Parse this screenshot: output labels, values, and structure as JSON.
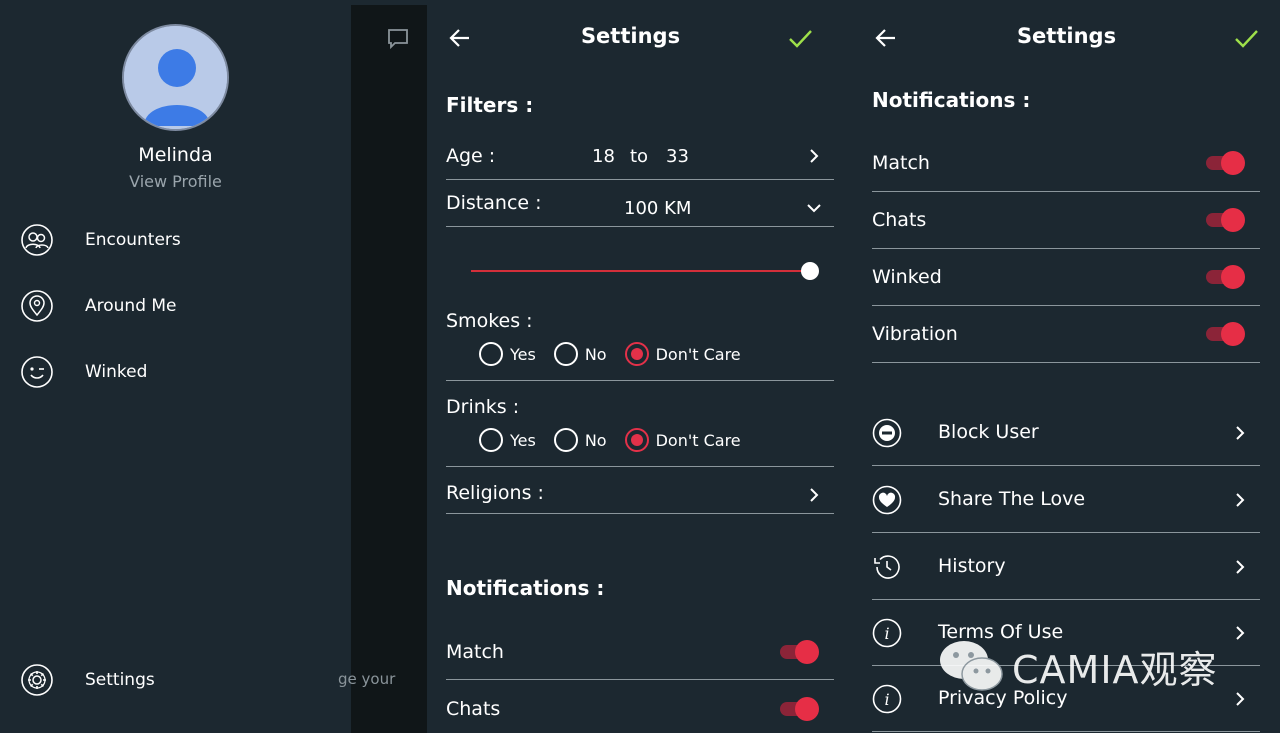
{
  "drawer": {
    "user_name": "Melinda",
    "view_profile": "View Profile",
    "menu": [
      {
        "label": "Encounters",
        "icon": "people-icon"
      },
      {
        "label": "Around Me",
        "icon": "location-pin-icon"
      },
      {
        "label": "Winked",
        "icon": "wink-face-icon"
      }
    ],
    "settings_label": "Settings",
    "overlay_text": "ge your"
  },
  "settings_filters": {
    "title": "Settings",
    "filters_header": "Filters :",
    "age_label": "Age :",
    "age_min": "18",
    "age_to": "to",
    "age_max": "33",
    "distance_label": "Distance :",
    "distance_value": "100 KM",
    "distance_slider_fraction": 1.0,
    "smokes_label": "Smokes :",
    "drinks_label": "Drinks :",
    "radio_options": [
      "Yes",
      "No",
      "Don't Care"
    ],
    "smokes_selected": "Don't Care",
    "drinks_selected": "Don't Care",
    "religions_label": "Religions :",
    "notifications_header": "Notifications :",
    "notifications": [
      {
        "label": "Match",
        "on": true
      },
      {
        "label": "Chats",
        "on": true
      }
    ]
  },
  "settings_notifications": {
    "title": "Settings",
    "notifications_header": "Notifications :",
    "notifications": [
      {
        "label": "Match",
        "on": true
      },
      {
        "label": "Chats",
        "on": true
      },
      {
        "label": "Winked",
        "on": true
      },
      {
        "label": "Vibration",
        "on": true
      }
    ],
    "links": [
      {
        "label": "Block User",
        "icon": "block-icon"
      },
      {
        "label": "Share The Love",
        "icon": "heart-icon"
      },
      {
        "label": "History",
        "icon": "history-icon"
      },
      {
        "label": "Terms Of Use",
        "icon": "info-icon"
      },
      {
        "label": "Privacy Policy",
        "icon": "info-icon"
      }
    ]
  },
  "watermark": "CAMIA观察",
  "colors": {
    "background": "#1c2830",
    "accent_red": "#e33149",
    "check_green": "#9ee04a"
  }
}
